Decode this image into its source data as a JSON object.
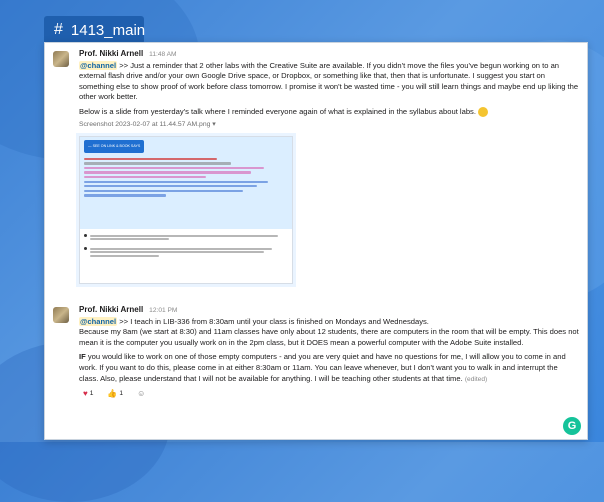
{
  "channel": {
    "hash": "#",
    "name": "1413_main"
  },
  "message1": {
    "author": "Prof. Nikki Arnell",
    "timestamp": "11:48 AM",
    "mention": "@channel",
    "text1": ">> Just a reminder that 2 other labs with the Creative Suite are available. If you didn't move the files you've begun working on to an external flash drive and/or your own Google Drive space, or Dropbox, or something like that, then that is unfortunate. I suggest you start on something else to show proof of work before class tomorrow. I promise it won't be wasted time - you will still learn things and maybe end up liking the other work better.",
    "text2": "Below is a slide from yesterday's talk where I reminded everyone again of what is explained in the syllabus about labs.",
    "file_name": "Screenshot 2023-02-07 at 11.44.57 AM.png",
    "file_caret": "▾"
  },
  "slide": {
    "chip": "— SEE ON LINK & BOOK SAYS"
  },
  "message2": {
    "author": "Prof. Nikki Arnell",
    "timestamp": "12:01 PM",
    "mention": "@channel",
    "text1": ">> I teach in LIB-336 from 8:30am until your class is finished on Mondays and Wednesdays.",
    "text2": "Because my 8am (we start at 8:30) and 11am classes have only about 12 students, there are computers in the room that will be empty. This does not mean it is the computer you usually work on in the 2pm class, but it DOES mean a powerful computer with the Adobe Suite installed.",
    "text3_bold": "IF",
    "text3": " you would like to work on one of those empty computers - and you are very quiet and have no questions for me, I will allow you to come in and work. If you want to do this, please come in at either 8:30am or 11am. You can leave whenever, but I don't want you to walk in and interrupt the class.  Also, please understand that I will not be available for anything. I will be teaching other students at that time.",
    "edited": "(edited)"
  },
  "reactions": [
    {
      "icon": "heart-icon",
      "glyph": "♥",
      "count": "1"
    },
    {
      "icon": "thumbs-up-icon",
      "glyph": "👍",
      "count": "1"
    }
  ],
  "grammarly": {
    "label": "G"
  }
}
